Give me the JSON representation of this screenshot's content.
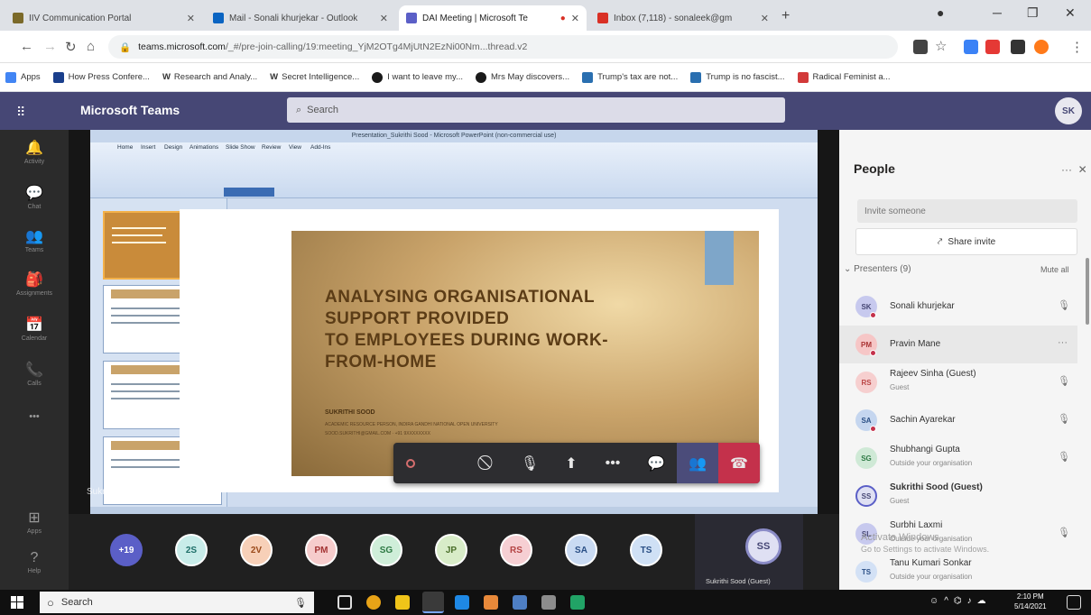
{
  "browser": {
    "tabs": [
      {
        "title": "IIV Communication Portal",
        "color": "#7b6a2a"
      },
      {
        "title": "Mail - Sonali khurjekar - Outlook",
        "color": "#0a64c2"
      },
      {
        "title": "DAI Meeting | Microsoft Te",
        "color": "#5b5fc7"
      },
      {
        "title": "Inbox (7,118) - sonaleek@gm",
        "color": "#d93025"
      }
    ],
    "url_host": "teams.microsoft.com",
    "url_rest": "/_#/pre-join-calling/19:meeting_YjM2OTg4MjUtN2EzNi00Nm...thread.v2",
    "bookmarks": [
      {
        "label": "Apps",
        "color": "#4285f4"
      },
      {
        "label": "How Press Confere...",
        "color": "#1a3f8c"
      },
      {
        "label": "Research and Analy...",
        "color": "#333333"
      },
      {
        "label": "Secret Intelligence...",
        "color": "#333333"
      },
      {
        "label": "I want to leave my...",
        "color": "#1a1a1a"
      },
      {
        "label": "Mrs May discovers...",
        "color": "#1a1a1a"
      },
      {
        "label": "Trump's tax are not...",
        "color": "#2a6fb0"
      },
      {
        "label": "Trump is no fascist...",
        "color": "#2a6fb0"
      },
      {
        "label": "Radical Feminist a...",
        "color": "#d23a3a"
      }
    ]
  },
  "teams": {
    "brand": "Microsoft Teams",
    "search_placeholder": "Search",
    "me_initials": "SK",
    "rail": [
      {
        "icon": "bell-icon",
        "glyph": "🔔",
        "label": "Activity"
      },
      {
        "icon": "chat-icon",
        "glyph": "💬",
        "label": "Chat"
      },
      {
        "icon": "teams-icon",
        "glyph": "👥",
        "label": "Teams"
      },
      {
        "icon": "assignments-icon",
        "glyph": "🎒",
        "label": "Assignments"
      },
      {
        "icon": "calendar-icon",
        "glyph": "📅",
        "label": "Calendar"
      },
      {
        "icon": "calls-icon",
        "glyph": "📞",
        "label": "Calls"
      },
      {
        "icon": "more-icon",
        "glyph": "•••",
        "label": ""
      },
      {
        "icon": "apps-icon",
        "glyph": "⊞",
        "label": "Apps"
      },
      {
        "icon": "help-icon",
        "glyph": "?",
        "label": "Help"
      }
    ]
  },
  "slide": {
    "window_title": "Presentation_Sukrithi Sood - Microsoft PowerPoint (non-commercial use)",
    "title": "ANALYSING ORGANISATIONAL\nSUPPORT PROVIDED\nTO EMPLOYEES DURING WORK-\nFROM-HOME",
    "author": "SUKRITHI SOOD",
    "affiliation_1": "ACADEMIC RESOURCE PERSON, INDIRA GANDHI NATIONAL OPEN UNIVERSITY",
    "affiliation_2": "SOOD.SUKRITHI@GMAIL.COM · +91 9XXXXXXXX",
    "ribbon_tabs": [
      "Home",
      "Insert",
      "Design",
      "Animations",
      "Slide Show",
      "Review",
      "View",
      "Add-Ins"
    ],
    "speaker_label": "Sukrithi Sood (Guest)"
  },
  "people": {
    "title": "People",
    "invite_placeholder": "Invite someone",
    "share_label": "Share invite",
    "presenters_label": "Presenters (9)",
    "mute_all": "Mute all",
    "list": [
      {
        "initials": "SK",
        "name": "Sonali khurjekar",
        "sub": "",
        "color": "#c7c9ee",
        "text": "#464775",
        "bold": false,
        "hl": false,
        "dot": true
      },
      {
        "initials": "PM",
        "name": "Pravin Mane",
        "sub": "",
        "color": "#f6c6c6",
        "text": "#a33",
        "bold": false,
        "hl": true,
        "dot": true
      },
      {
        "initials": "RS",
        "name": "Rajeev Sinha (Guest)",
        "sub": "Guest",
        "color": "#f6cfcf",
        "text": "#b44",
        "bold": false,
        "hl": false,
        "dot": false
      },
      {
        "initials": "SA",
        "name": "Sachin Ayarekar",
        "sub": "",
        "color": "#c5d6ef",
        "text": "#2a4f85",
        "bold": false,
        "hl": false,
        "dot": true
      },
      {
        "initials": "SG",
        "name": "Shubhangi Gupta",
        "sub": "Outside your organisation",
        "color": "#cfe9d6",
        "text": "#2e7a45",
        "bold": false,
        "hl": false,
        "dot": false
      },
      {
        "initials": "SS",
        "name": "Sukrithi Sood (Guest)",
        "sub": "Guest",
        "color": "#dfe0f3",
        "text": "#464775",
        "bold": true,
        "hl": false,
        "dot": false
      },
      {
        "initials": "SL",
        "name": "Surbhi Laxmi",
        "sub": "Outside your organisation",
        "color": "#c7c9ee",
        "text": "#464775",
        "bold": false,
        "hl": false,
        "dot": false
      },
      {
        "initials": "TS",
        "name": "Tanu Kumari Sonkar",
        "sub": "Outside your organisation",
        "color": "#d3e1f5",
        "text": "#2a4f85",
        "bold": false,
        "hl": false,
        "dot": false
      }
    ],
    "watermark_1": "Activate Windows",
    "watermark_2": "Go to Settings to activate Windows."
  },
  "strip": {
    "participants": [
      {
        "label": "+19",
        "color": "#5b5fc7",
        "text": "#ffffff"
      },
      {
        "label": "2S",
        "color": "#c8ece9",
        "text": "#1e6e68"
      },
      {
        "label": "2V",
        "color": "#f7d0b8",
        "text": "#9a4a1a"
      },
      {
        "label": "PM",
        "color": "#f6cccc",
        "text": "#a33333"
      },
      {
        "label": "SG",
        "color": "#cfeed9",
        "text": "#2e7a45"
      },
      {
        "label": "JP",
        "color": "#d8ecc8",
        "text": "#4a6e2a"
      },
      {
        "label": "RS",
        "color": "#f6cfd3",
        "text": "#b44444"
      },
      {
        "label": "SA",
        "color": "#c9daf2",
        "text": "#2a4f85"
      },
      {
        "label": "TS",
        "color": "#cfe0f5",
        "text": "#2a4f85"
      }
    ],
    "self_initials": "SS",
    "self_name": "Sukrithi Sood (Guest)"
  },
  "taskbar": {
    "search_placeholder": "Search",
    "time": "2:10 PM",
    "date": "5/14/2021",
    "apps": [
      "#2d7be4",
      "#e8a317",
      "#f0c419",
      "#d83b01",
      "#1e88e5",
      "#e8893a",
      "#4e7fc4",
      "#8c8c8c",
      "#21a366"
    ]
  }
}
